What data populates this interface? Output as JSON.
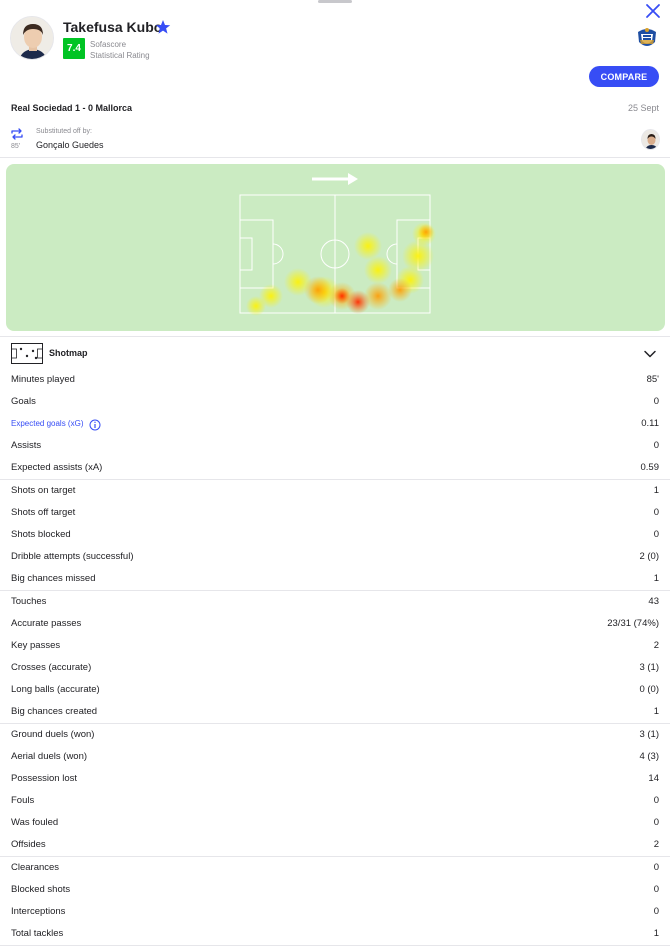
{
  "player": {
    "name": "Takefusa Kubo",
    "rating": "7.4",
    "rating_source": "Sofascore",
    "rating_label": "Statistical Rating",
    "rating_color": "#00c424"
  },
  "actions": {
    "compare_label": "COMPARE",
    "accent": "#374df5"
  },
  "match": {
    "title": "Real Sociedad 1 - 0 Mallorca",
    "date": "25 Sept"
  },
  "substitution": {
    "minute": "85'",
    "label": "Substituted off by:",
    "player": "Gonçalo Guedes"
  },
  "shotmap": {
    "label": "Shotmap"
  },
  "icons": [
    "close-icon",
    "star-icon",
    "substitution-icon",
    "info-icon",
    "chevron-down-icon",
    "pitch-icon",
    "direction-arrow-icon"
  ],
  "stat_groups": [
    [
      {
        "label": "Minutes played",
        "value": "85'"
      },
      {
        "label": "Goals",
        "value": "0"
      },
      {
        "label": "Expected goals (xG)",
        "value": "0.11",
        "link": true
      },
      {
        "label": "Assists",
        "value": "0"
      },
      {
        "label": "Expected assists (xA)",
        "value": "0.59"
      }
    ],
    [
      {
        "label": "Shots on target",
        "value": "1"
      },
      {
        "label": "Shots off target",
        "value": "0"
      },
      {
        "label": "Shots blocked",
        "value": "0"
      },
      {
        "label": "Dribble attempts (successful)",
        "value": "2 (0)"
      },
      {
        "label": "Big chances missed",
        "value": "1"
      }
    ],
    [
      {
        "label": "Touches",
        "value": "43"
      },
      {
        "label": "Accurate passes",
        "value": "23/31 (74%)"
      },
      {
        "label": "Key passes",
        "value": "2"
      },
      {
        "label": "Crosses (accurate)",
        "value": "3 (1)"
      },
      {
        "label": "Long balls (accurate)",
        "value": "0 (0)"
      },
      {
        "label": "Big chances created",
        "value": "1"
      }
    ],
    [
      {
        "label": "Ground duels (won)",
        "value": "3 (1)"
      },
      {
        "label": "Aerial duels (won)",
        "value": "4 (3)"
      },
      {
        "label": "Possession lost",
        "value": "14"
      },
      {
        "label": "Fouls",
        "value": "0"
      },
      {
        "label": "Was fouled",
        "value": "0"
      },
      {
        "label": "Offsides",
        "value": "2"
      }
    ],
    [
      {
        "label": "Clearances",
        "value": "0"
      },
      {
        "label": "Blocked shots",
        "value": "0"
      },
      {
        "label": "Interceptions",
        "value": "0"
      },
      {
        "label": "Total tackles",
        "value": "1"
      }
    ]
  ]
}
